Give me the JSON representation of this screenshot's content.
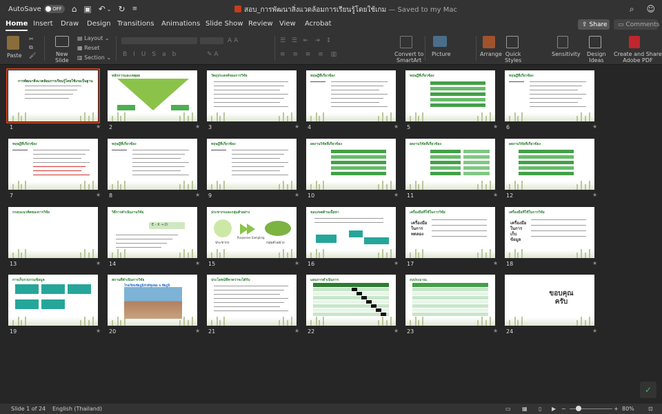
{
  "titlebar": {
    "autosave": "AutoSave",
    "toggle": "OFF",
    "doc_title": "สอบ_การพัฒนาสิ่งแวดล้อมการเรียนรู้โดยใช้เกม",
    "saved": " — Saved to my Mac"
  },
  "tabs": [
    "Home",
    "Insert",
    "Draw",
    "Design",
    "Transitions",
    "Animations",
    "Slide Show",
    "Review",
    "View",
    "Acrobat"
  ],
  "active_tab": "Home",
  "share_label": "Share",
  "comments_label": "Comments",
  "ribbon": {
    "paste": "Paste",
    "new_slide": [
      "New",
      "Slide"
    ],
    "layout": "Layout",
    "reset": "Reset",
    "section": "Section",
    "convert": [
      "Convert to",
      "SmartArt"
    ],
    "picture": "Picture",
    "arrange": "Arrange",
    "quick_styles": [
      "Quick",
      "Styles"
    ],
    "sensitivity": "Sensitivity",
    "design_ideas": [
      "Design",
      "Ideas"
    ],
    "create_share": [
      "Create and Share",
      "Adobe PDF"
    ]
  },
  "slides": [
    {
      "n": "1",
      "title": "การพัฒนาสิ่งแวดล้อมการเรียนรู้โดยใช้เกมเป็นฐาน"
    },
    {
      "n": "2",
      "title": "หลักการและเหตุผล"
    },
    {
      "n": "3",
      "title": "วัตถุประสงค์ของการวิจัย"
    },
    {
      "n": "4",
      "title": "ทฤษฎีที่เกี่ยวข้อง"
    },
    {
      "n": "5",
      "title": "ทฤษฎีที่เกี่ยวข้อง"
    },
    {
      "n": "6",
      "title": "ทฤษฎีที่เกี่ยวข้อง"
    },
    {
      "n": "7",
      "title": "ทฤษฎีที่เกี่ยวข้อง"
    },
    {
      "n": "8",
      "title": "ทฤษฎีที่เกี่ยวข้อง"
    },
    {
      "n": "9",
      "title": "ทฤษฎีที่เกี่ยวข้อง"
    },
    {
      "n": "10",
      "title": "ผลงานวิจัยที่เกี่ยวข้อง"
    },
    {
      "n": "11",
      "title": "ผลงานวิจัยที่เกี่ยวข้อง"
    },
    {
      "n": "12",
      "title": "ผลงานวิจัยที่เกี่ยวข้อง"
    },
    {
      "n": "13",
      "title": "กรอบแนวคิดของการวิจัย"
    },
    {
      "n": "14",
      "title": "วิธีการดำเนินงานวิจัย"
    },
    {
      "n": "15",
      "title": "ประชากรและกลุ่มตัวอย่าง"
    },
    {
      "n": "16",
      "title": "ขอบเขตด้านเนื้อหา"
    },
    {
      "n": "17",
      "title": "เครื่องมือที่ใช้ในการวิจัย"
    },
    {
      "n": "18",
      "title": "เครื่องมือที่ใช้ในการวิจัย"
    },
    {
      "n": "19",
      "title": "การเก็บรวบรวมข้อมูล"
    },
    {
      "n": "20",
      "title": "สถานที่ดำเนินการวิจัย"
    },
    {
      "n": "21",
      "title": "ประโยชน์ที่คาดว่าจะได้รับ"
    },
    {
      "n": "22",
      "title": "แผนการดำเนินการ"
    },
    {
      "n": "23",
      "title": "งบประมาณ"
    },
    {
      "n": "24",
      "title": ""
    }
  ],
  "slide24_text": "ขอบคุณ ครับ",
  "slide20_caption": "โรงเรียนชัยภูมิภักดีชุมพล จ.ชัยภูมิ",
  "slide14_formula": "E  -  X  →  O",
  "slide15_labels": {
    "left": "ประชากร",
    "right": "กลุ่มตัวอย่าง",
    "middle": "Purposive Sampling"
  },
  "slide17_labels": [
    "เครื่องมือ",
    "ในการ",
    "ทดลอง"
  ],
  "slide18_labels": [
    "เครื่องมือ",
    "ในการ",
    "เก็บ",
    "ข้อมูล"
  ],
  "status": {
    "slide": "Slide 1 of 24",
    "language": "English (Thailand)",
    "zoom": "80%"
  },
  "colors": {
    "accent": "#c43e1c",
    "green": "#2e7d32",
    "bg": "#262626"
  }
}
